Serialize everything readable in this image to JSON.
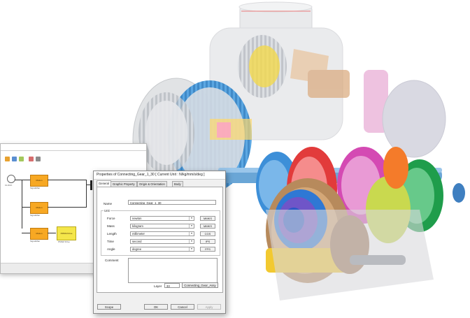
{
  "colors": {
    "block_orange": "#f7a823",
    "block_yellow": "#f4e64a",
    "dialog_bg": "#f0f0f0"
  },
  "background_app": {
    "title": "",
    "ribbon_tabs": [
      "",
      "",
      "",
      "",
      ""
    ],
    "blocks": [
      {
        "label": "Motion"
      },
      {
        "label": "Motion"
      },
      {
        "label": "Motion"
      },
      {
        "label": "PMSM Drive"
      }
    ],
    "block_captions": [
      "SignalMan",
      "SignalMan",
      "SignalMan",
      "PMSM Drive"
    ],
    "clock_label": "CLOCK"
  },
  "dialog": {
    "title": "Properties of Connecting_Gear_1_30 [ Current Unit : N/kg/mm/s/deg ]",
    "tabs": [
      "General",
      "Graphic Property",
      "Origin & Orientation",
      "Body"
    ],
    "name_label": "Name",
    "name_value": "Connecting_Gear_1_30",
    "unit_group_title": "Unit",
    "units": [
      {
        "label": "Force",
        "value": "newton",
        "system": "MMKS"
      },
      {
        "label": "Mass",
        "value": "kilogram",
        "system": "MMKS"
      },
      {
        "label": "Length",
        "value": "millimeter",
        "system": "CGS"
      },
      {
        "label": "Time",
        "value": "second",
        "system": "IPS"
      },
      {
        "label": "Angle",
        "value": "degree",
        "system": "FPS"
      }
    ],
    "comment_label": "Comment",
    "layer_label": "Layer",
    "layer_value": "33",
    "layer_button": "Connecting_Gear_Assy",
    "buttons": {
      "scope": "Scope",
      "ok": "OK",
      "cancel": "Cancel",
      "apply": "Apply"
    }
  }
}
